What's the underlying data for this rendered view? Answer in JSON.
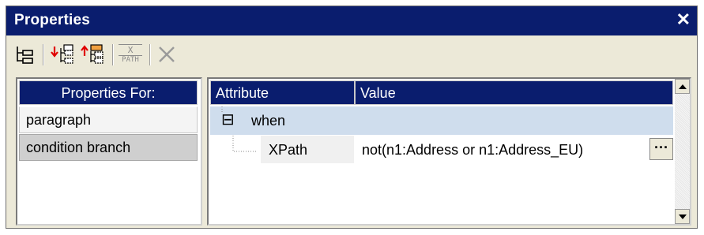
{
  "window": {
    "title": "Properties",
    "close_label": "✕"
  },
  "toolbar": {
    "icons": [
      "tree-view-icon",
      "add-child-icon",
      "insert-before-icon",
      "xpath-icon",
      "delete-icon"
    ],
    "xpath_icon_top": "X",
    "xpath_icon_bottom": "PATH"
  },
  "left_panel": {
    "header": "Properties For:",
    "items": [
      {
        "label": "paragraph"
      },
      {
        "label": "condition branch"
      }
    ]
  },
  "right_panel": {
    "columns": [
      "Attribute",
      "Value"
    ],
    "group": {
      "toggle": "⊟",
      "label": "when"
    },
    "rows": [
      {
        "attribute": "XPath",
        "value": "not(n1:Address or  n1:Address_EU)",
        "edit_label": "···"
      }
    ]
  },
  "colors": {
    "titlebar": "#0a1d6e",
    "header": "#0a1d6e",
    "selected_row": "#cfdded",
    "panel_bg": "#ece9d8"
  }
}
